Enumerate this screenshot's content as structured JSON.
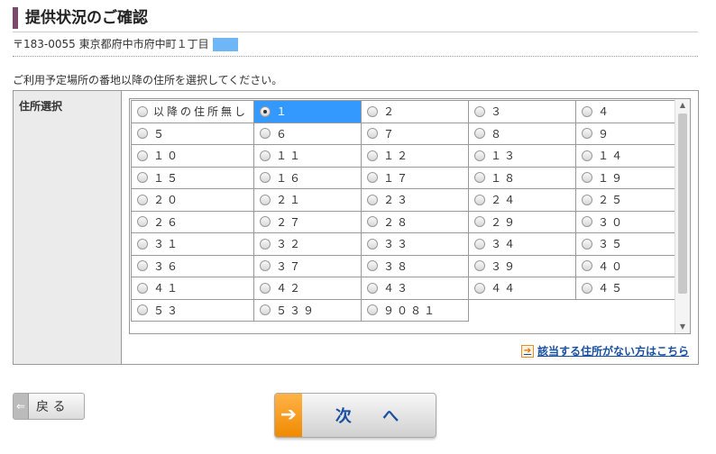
{
  "page": {
    "title": "提供状況のご確認",
    "address": "〒183-0055 東京都府中市府中町１丁目",
    "instruction": "ご利用予定場所の番地以降の住所を選択してください。"
  },
  "panel": {
    "label": "住所選択",
    "options": [
      [
        "以降の住所無し",
        "１",
        "２",
        "３",
        "４"
      ],
      [
        "５",
        "６",
        "７",
        "８",
        "９"
      ],
      [
        "１０",
        "１１",
        "１２",
        "１３",
        "１４"
      ],
      [
        "１５",
        "１６",
        "１７",
        "１８",
        "１９"
      ],
      [
        "２０",
        "２１",
        "２３",
        "２４",
        "２５"
      ],
      [
        "２６",
        "２７",
        "２８",
        "２９",
        "３０"
      ],
      [
        "３１",
        "３２",
        "３３",
        "３４",
        "３５"
      ],
      [
        "３６",
        "３７",
        "３８",
        "３９",
        "４０"
      ],
      [
        "４１",
        "４２",
        "４３",
        "４４",
        "４５"
      ],
      [
        "５３",
        "５３９",
        "９０８１"
      ]
    ],
    "selected": "１",
    "no_match_link": "該当する住所がない方はこちら"
  },
  "buttons": {
    "back": "戻 る",
    "next": "次 へ"
  },
  "colors": {
    "selected_bg": "#3399ff",
    "accent_orange": "#f08a00",
    "link_blue": "#1a4fa0"
  }
}
